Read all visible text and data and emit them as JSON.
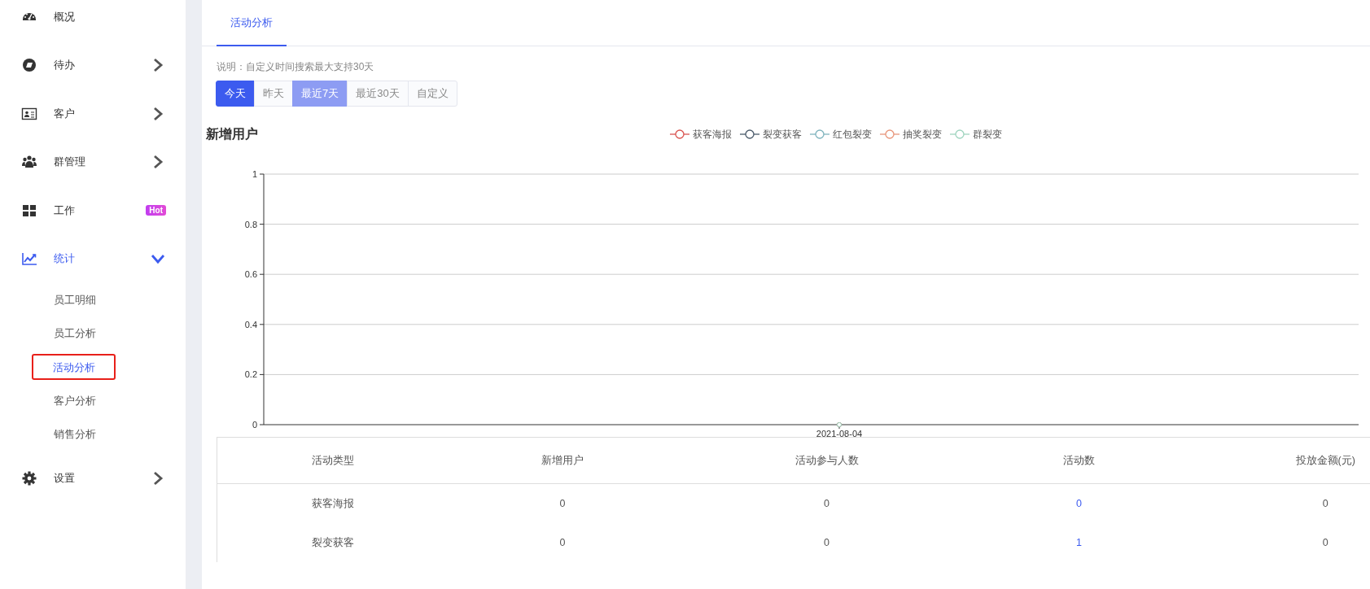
{
  "sidebar": {
    "items": [
      {
        "label": "概况",
        "selected": false
      },
      {
        "label": "待办",
        "expanded": false,
        "selected": false
      },
      {
        "label": "客户",
        "expanded": false,
        "selected": false
      },
      {
        "label": "群管理",
        "expanded": false,
        "selected": false
      },
      {
        "label": "工作",
        "selected": false,
        "badge": "Hot"
      },
      {
        "label": "统计",
        "expanded": true,
        "selected": true,
        "children": [
          {
            "label": "员工明细",
            "selected": false,
            "highlighted": false
          },
          {
            "label": "员工分析",
            "selected": false,
            "highlighted": false
          },
          {
            "label": "活动分析",
            "selected": true,
            "highlighted": true
          },
          {
            "label": "客户分析",
            "selected": false,
            "highlighted": false
          },
          {
            "label": "销售分析",
            "selected": false,
            "highlighted": false
          }
        ]
      },
      {
        "label": "设置",
        "expanded": false,
        "selected": false
      }
    ]
  },
  "tabs": [
    {
      "label": "活动分析",
      "selected": true
    }
  ],
  "note": "说明：自定义时间搜索最大支持30天",
  "range_buttons": [
    {
      "label": "今天",
      "selected": true,
      "hover": false
    },
    {
      "label": "昨天",
      "selected": false,
      "hover": false
    },
    {
      "label": "最近7天",
      "selected": false,
      "hover": true
    },
    {
      "label": "最近30天",
      "selected": false,
      "hover": false
    },
    {
      "label": "自定义",
      "selected": false,
      "hover": false
    }
  ],
  "chart": {
    "chart_data": {
      "type": "line",
      "title": "新增用户",
      "categories": [
        "2021-08-04"
      ],
      "ylim": [
        0,
        1
      ],
      "grid": true,
      "yticks": [
        0,
        0.2,
        0.4,
        0.6,
        0.8,
        1
      ],
      "series": [
        {
          "name": "获客海报",
          "color": "#d9534f",
          "marker": "circle",
          "values": [
            0
          ]
        },
        {
          "name": "裂变获客",
          "color": "#4a5a6a",
          "marker": "circle",
          "values": [
            0
          ]
        },
        {
          "name": "红包裂变",
          "color": "#7fb3bd",
          "marker": "circle",
          "values": [
            0
          ]
        },
        {
          "name": "抽奖裂变",
          "color": "#e8957a",
          "marker": "circle",
          "values": [
            0
          ]
        },
        {
          "name": "群裂变",
          "color": "#9fd4bf",
          "marker": "circle",
          "values": [
            0
          ]
        }
      ]
    }
  },
  "table": {
    "columns": [
      "活动类型",
      "新增用户",
      "活动参与人数",
      "活动数",
      "投放金额(元)"
    ],
    "rows": [
      [
        {
          "text": "获客海报",
          "kind": "text"
        },
        {
          "text": "0",
          "kind": "text"
        },
        {
          "text": "0",
          "kind": "text"
        },
        {
          "text": "0",
          "kind": "link"
        },
        {
          "text": "0",
          "kind": "text"
        }
      ],
      [
        {
          "text": "裂变获客",
          "kind": "text"
        },
        {
          "text": "0",
          "kind": "text"
        },
        {
          "text": "0",
          "kind": "text"
        },
        {
          "text": "1",
          "kind": "link"
        },
        {
          "text": "0",
          "kind": "text"
        }
      ]
    ]
  }
}
